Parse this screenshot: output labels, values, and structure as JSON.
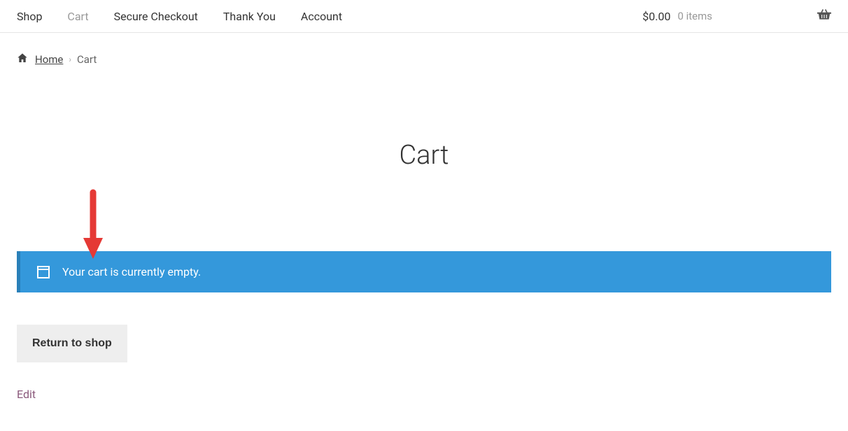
{
  "nav": {
    "items": [
      {
        "label": "Shop",
        "active": false
      },
      {
        "label": "Cart",
        "active": true
      },
      {
        "label": "Secure Checkout",
        "active": false
      },
      {
        "label": "Thank You",
        "active": false
      },
      {
        "label": "Account",
        "active": false
      }
    ],
    "cart_total": "$0.00",
    "cart_items": "0 items"
  },
  "breadcrumb": {
    "home_label": "Home",
    "current": "Cart"
  },
  "page": {
    "title": "Cart"
  },
  "notice": {
    "message": "Your cart is currently empty."
  },
  "actions": {
    "return_label": "Return to shop",
    "edit_label": "Edit"
  },
  "colors": {
    "notice_bg": "#3498db",
    "notice_accent": "#2980b9",
    "arrow": "#e53935"
  }
}
